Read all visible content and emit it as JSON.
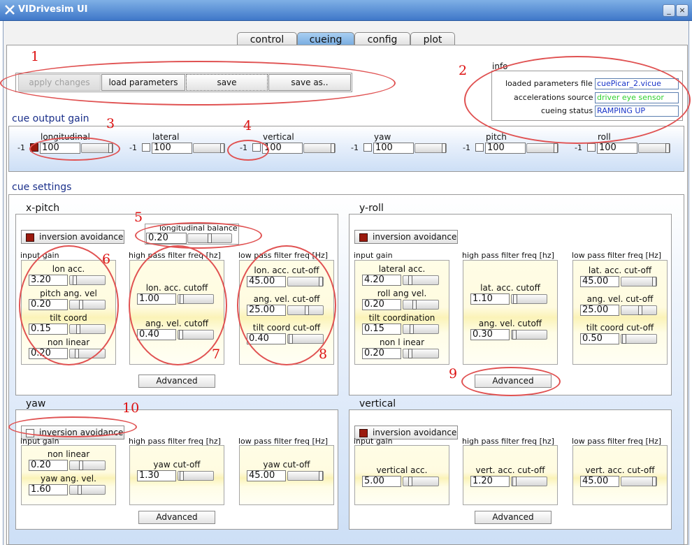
{
  "window": {
    "title": "VIDrivesim UI",
    "minimize": "_",
    "maximize": "□",
    "close": "×"
  },
  "tabs": [
    "control",
    "cueing",
    "config",
    "plot"
  ],
  "toolbar": {
    "apply": "apply changes",
    "load": "load parameters",
    "save": "save",
    "save_as": "save as.."
  },
  "info": {
    "title": "info",
    "params_label": "loaded parameters file",
    "params_value": "cuePicar_2.vicue",
    "accel_label": "accelerations source",
    "accel_value": "driver eye sensor",
    "status_label": "cueing status",
    "status_value": "RAMPING UP"
  },
  "colors": {
    "accel_value": "#2fd02f",
    "params_value": "#1a36c9",
    "status_value": "#1a36c9",
    "checked": "#9b1a0e"
  },
  "output_gain": {
    "title": "cue output gain",
    "neg_label": "-1",
    "channels": [
      {
        "name": "longitudinal",
        "value": "100",
        "checked": true,
        "level": 1.0
      },
      {
        "name": "lateral",
        "value": "100",
        "checked": false,
        "level": 1.0
      },
      {
        "name": "vertical",
        "value": "100",
        "checked": false,
        "level": 1.0
      },
      {
        "name": "yaw",
        "value": "100",
        "checked": false,
        "level": 1.0
      },
      {
        "name": "pitch",
        "value": "100",
        "checked": false,
        "level": 1.0
      },
      {
        "name": "roll",
        "value": "100",
        "checked": false,
        "level": 1.0
      }
    ]
  },
  "cue_settings": {
    "title": "cue settings",
    "headers": {
      "input": "input gain",
      "hp": "high pass filter freq [hz]",
      "lp": "low pass filter freq [Hz]"
    },
    "advanced": "Advanced",
    "inv_label": "inversion avoidance",
    "xpitch": {
      "title": "x-pitch",
      "inv_checked": true,
      "balance_label": "longitudinal balance",
      "balance_value": "0.20",
      "balance_level": 0.5,
      "input": [
        {
          "label": "lon acc.",
          "value": "3.20",
          "level": 0.1
        },
        {
          "label": "pitch ang. vel",
          "value": "0.20",
          "level": 0.3
        },
        {
          "label": "tilt coord",
          "value": "0.15",
          "level": 0.2
        },
        {
          "label": "non linear",
          "value": "0.20",
          "level": 0.15
        }
      ],
      "hp": [
        {
          "label": "lon. acc. cutoff",
          "value": "1.00",
          "level": 0.05
        },
        {
          "label": "ang. vel. cutoff",
          "value": "0.40",
          "level": 0.02
        }
      ],
      "lp": [
        {
          "label": "lon. acc. cut-off",
          "value": "45.00",
          "level": 1.0
        },
        {
          "label": "ang. vel. cut-off",
          "value": "25.00",
          "level": 0.55
        },
        {
          "label": "tilt coord cut-off",
          "value": "0.40",
          "level": 0.02
        }
      ]
    },
    "yroll": {
      "title": "y-roll",
      "inv_checked": true,
      "input": [
        {
          "label": "lateral  acc.",
          "value": "4.20",
          "level": 0.15
        },
        {
          "label": "roll ang vel.",
          "value": "0.20",
          "level": 0.3
        },
        {
          "label": "tilt coordination",
          "value": "0.15",
          "level": 0.2
        },
        {
          "label": "non l inear",
          "value": "0.20",
          "level": 0.15
        }
      ],
      "hp": [
        {
          "label": "lat. acc. cutoff",
          "value": "1.10",
          "level": 0.05
        },
        {
          "label": "ang. vel. cutoff",
          "value": "0.30",
          "level": 0.02
        }
      ],
      "lp": [
        {
          "label": "lat. acc. cut-off",
          "value": "45.00",
          "level": 1.0
        },
        {
          "label": "ang. vel. cut-off",
          "value": "25.00",
          "level": 0.55
        },
        {
          "label": "tilt coord cut-off",
          "value": "0.50",
          "level": 0.02
        }
      ]
    },
    "yaw": {
      "title": "yaw",
      "inv_checked": false,
      "input": [
        {
          "label": "non linear",
          "value": "0.20",
          "level": 0.3
        },
        {
          "label": "yaw ang. vel.",
          "value": "1.60",
          "level": 0.25
        }
      ],
      "hp": [
        {
          "label": "yaw cut-off",
          "value": "1.30",
          "level": 0.05
        }
      ],
      "lp": [
        {
          "label": "yaw cut-off",
          "value": "45.00",
          "level": 1.0
        }
      ]
    },
    "vertical": {
      "title": "vertical",
      "inv_checked": true,
      "input": [
        {
          "label": "vertical acc.",
          "value": "5.00",
          "level": 0.15
        }
      ],
      "hp": [
        {
          "label": "vert. acc. cut-off",
          "value": "1.20",
          "level": 0.02
        }
      ],
      "lp": [
        {
          "label": "vert. acc. cut-off",
          "value": "45.00",
          "level": 1.0
        }
      ]
    }
  },
  "annotations": [
    "1",
    "2",
    "3",
    "4",
    "5",
    "6",
    "7",
    "8",
    "9",
    "10"
  ]
}
